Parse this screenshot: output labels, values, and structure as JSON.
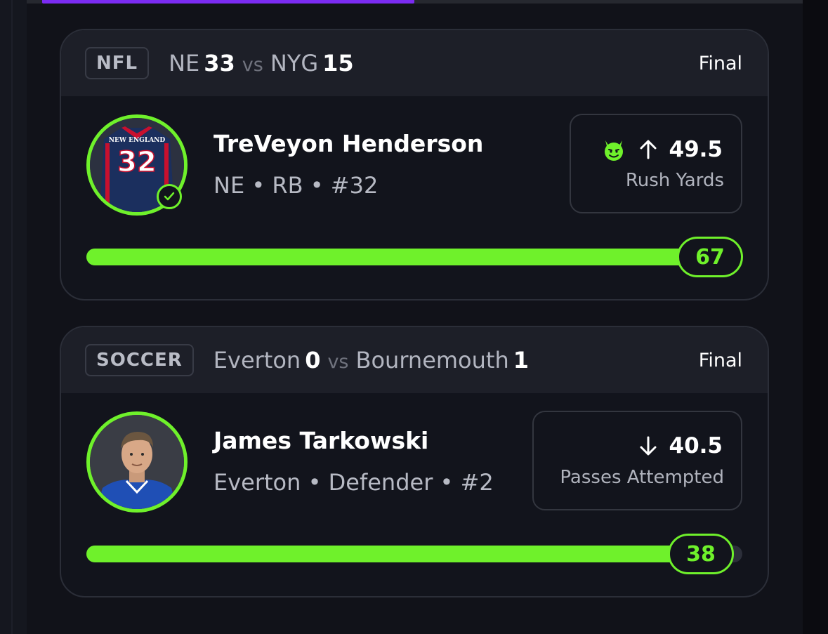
{
  "cards": [
    {
      "league": "NFL",
      "home_team": "NE",
      "home_score": "33",
      "vs": "vs",
      "away_team": "NYG",
      "away_score": "15",
      "status": "Final",
      "player_name": "TreVeyon Henderson",
      "player_meta": "NE • RB • #32",
      "jersey_text": "NEW ENGLAND",
      "jersey_number": "32",
      "pick_direction_icon": "arrow-up-icon",
      "pick_line": "49.5",
      "pick_stat": "Rush Yards",
      "result": "67",
      "progress_fraction": 0.98
    },
    {
      "league": "SOCCER",
      "home_team": "Everton",
      "home_score": "0",
      "vs": "vs",
      "away_team": "Bournemouth",
      "away_score": "1",
      "status": "Final",
      "player_name": "James Tarkowski",
      "player_meta": "Everton • Defender • #2",
      "pick_direction_icon": "arrow-down-icon",
      "pick_line": "40.5",
      "pick_stat": "Passes Attempted",
      "result": "38",
      "progress_fraction": 0.94
    }
  ],
  "colors": {
    "accent_green": "#6ff12b",
    "tab_purple": "#7b2bf2",
    "card_background": "#12141c",
    "header_background": "#1d1f28"
  }
}
